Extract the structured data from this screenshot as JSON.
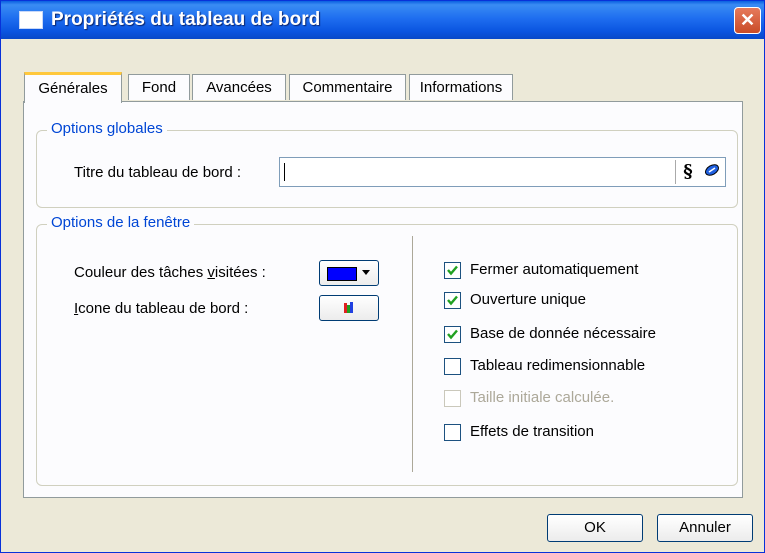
{
  "window": {
    "title": "Propriétés du tableau de bord",
    "close_glyph": "✕"
  },
  "tabs": [
    {
      "label": "Générales",
      "active": true
    },
    {
      "label": "Fond"
    },
    {
      "label": "Avancées"
    },
    {
      "label": "Commentaire"
    },
    {
      "label": "Informations"
    }
  ],
  "global_options": {
    "group_title": "Options globales",
    "title_label": "Titre du tableau de bord :",
    "title_value": "",
    "section_button": "§"
  },
  "window_options": {
    "group_title": "Options de la fenêtre",
    "visited_color_label_pre": "Couleur des tâches ",
    "visited_color_label_u": "v",
    "visited_color_label_post": "isitées :",
    "visited_color": "#0000ff",
    "icon_label_u": "I",
    "icon_label_post": "cone du tableau de bord :",
    "checkboxes": [
      {
        "label": "Fermer automatiquement",
        "checked": true,
        "enabled": true
      },
      {
        "label": "Ouverture unique",
        "checked": true,
        "enabled": true
      },
      {
        "label": "Base de donnée nécessaire",
        "checked": true,
        "enabled": true
      },
      {
        "label": "Tableau redimensionnable",
        "checked": false,
        "enabled": true
      },
      {
        "label": "Taille initiale calculée.",
        "checked": false,
        "enabled": false
      },
      {
        "label": "Effets de transition",
        "checked": false,
        "enabled": true
      }
    ]
  },
  "buttons": {
    "ok": "OK",
    "cancel": "Annuler"
  },
  "colors": {
    "title_bar": "#0a54e0",
    "accent_group_title": "#0046d5",
    "check_mark": "#21a121"
  }
}
